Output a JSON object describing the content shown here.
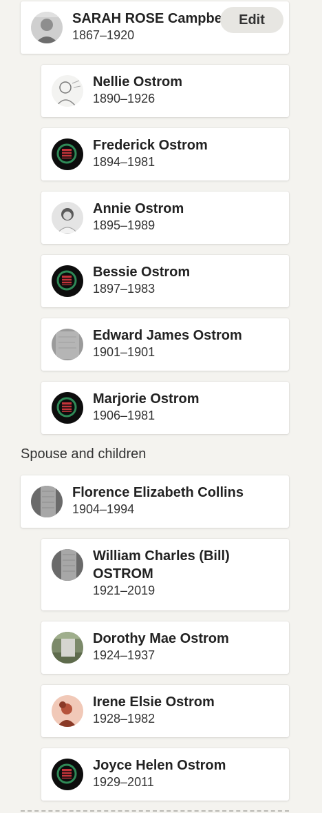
{
  "parent": {
    "name": "SARAH ROSE Campbell",
    "dates": "1867–1920",
    "avatar": "photo-portrait-icon",
    "edit_label": "Edit"
  },
  "children": [
    {
      "name": "Nellie Ostrom",
      "dates": "1890–1926",
      "avatar": "sketch-portrait-icon"
    },
    {
      "name": "Frederick Ostrom",
      "dates": "1894–1981",
      "avatar": "emblem-icon"
    },
    {
      "name": "Annie Ostrom",
      "dates": "1895–1989",
      "avatar": "photo-portrait-icon"
    },
    {
      "name": "Bessie Ostrom",
      "dates": "1897–1983",
      "avatar": "emblem-icon"
    },
    {
      "name": "Edward James Ostrom",
      "dates": "1901–1901",
      "avatar": "gravestone-photo-icon"
    },
    {
      "name": "Marjorie Ostrom",
      "dates": "1906–1981",
      "avatar": "emblem-icon"
    }
  ],
  "spouse_section": {
    "label": "Spouse and children",
    "spouse": {
      "name": "Florence Elizabeth Collins",
      "dates": "1904–1994",
      "avatar": "gravestone-photo-icon"
    },
    "children": [
      {
        "name": "William Charles (Bill) OSTROM",
        "dates": "1921–2019",
        "avatar": "gravestone-photo-icon"
      },
      {
        "name": "Dorothy Mae Ostrom",
        "dates": "1924–1937",
        "avatar": "grave-outdoor-photo-icon"
      },
      {
        "name": "Irene Elsie Ostrom",
        "dates": "1928–1982",
        "avatar": "female-silhouette-icon"
      },
      {
        "name": "Joyce Helen Ostrom",
        "dates": "1929–2011",
        "avatar": "emblem-icon"
      }
    ]
  },
  "colors": {
    "background": "#f4f3ef",
    "card": "#ffffff",
    "emblem_red": "#c4343a",
    "emblem_green": "#2f8a57"
  }
}
